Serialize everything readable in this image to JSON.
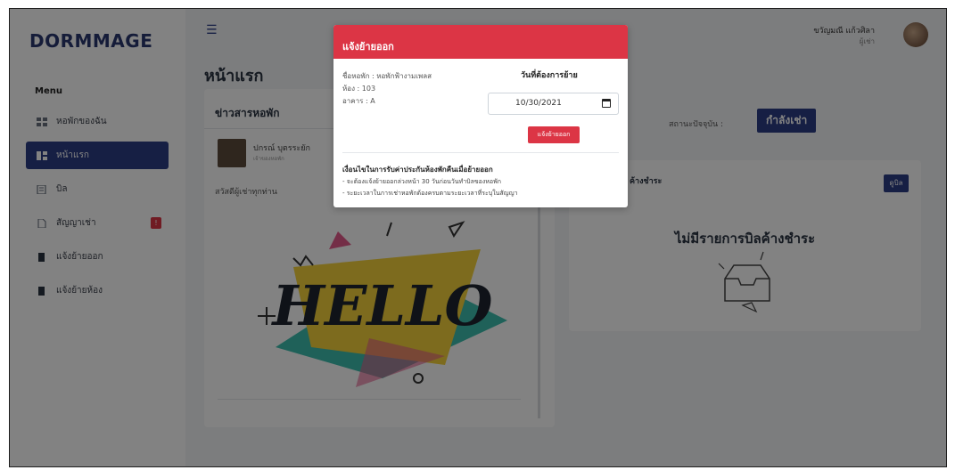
{
  "sidebar": {
    "brand": "DORMMAGE",
    "menu_title": "Menu",
    "items": [
      {
        "label": "หอพักของฉัน",
        "icon": "grid-icon",
        "active": false
      },
      {
        "label": "หน้าแรก",
        "icon": "dashboard-icon",
        "active": true
      },
      {
        "label": "บิล",
        "icon": "bill-icon",
        "active": false
      },
      {
        "label": "สัญญาเช่า",
        "icon": "document-icon",
        "active": false,
        "badge": "!"
      },
      {
        "label": "แจ้งย้ายออก",
        "icon": "bookmark-icon",
        "active": false
      },
      {
        "label": "แจ้งย้ายห้อง",
        "icon": "bookmark-icon",
        "active": false
      }
    ]
  },
  "header": {
    "user_name": "ขวัญมณี แก้วศิลา",
    "user_role": "ผู้เช่า"
  },
  "main": {
    "page_title": "หน้าแรก",
    "news": {
      "title": "ข่าวสารหอพัก",
      "author": "ปกรณ์ บุตรระยัก",
      "author_sub": "เจ้าของหอพัก",
      "text": "สวัสดีผู้เช่าทุกท่าน",
      "image_text": "HELLO"
    },
    "status": {
      "label": "สถานะปัจจุบัน :",
      "value": "กำลังเช่า"
    },
    "bills": {
      "title": "ค้างชำระ",
      "button": "ดูบิล",
      "empty": "ไม่มีรายการบิลค้างชำระ"
    }
  },
  "modal": {
    "title": "แจ้งย้ายออก",
    "dorm": "ชื่อหอพัก : หอพักฟ้างามเพลส",
    "room": "ห้อง : 103",
    "building": "อาคาร : A",
    "date_title": "วันที่ต้องการย้าย",
    "date_value": "10/30/2021",
    "submit": "แจ้งย้ายออก",
    "cond_title": "เงื่อนไขในการรับค่าประกันห้องพักคืนเมื่อย้ายออก",
    "cond_1": "- จะต้องแจ้งย้ายออกล่วงหน้า 30 วันก่อนวันทำบิลของหอพัก",
    "cond_2": "- ระยะเวลาในการเช่าหอพักต้องครบตามระยะเวลาที่ระบุในสัญญา"
  },
  "colors": {
    "brand_blue": "#2c3e86",
    "danger_red": "#dc3545"
  }
}
